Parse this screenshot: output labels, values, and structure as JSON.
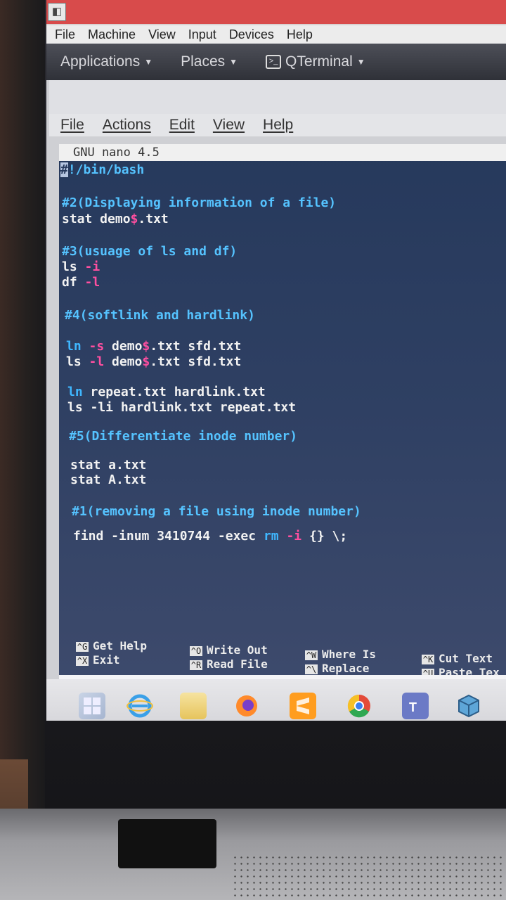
{
  "vbox": {
    "menu": [
      "File",
      "Machine",
      "View",
      "Input",
      "Devices",
      "Help"
    ]
  },
  "gnome_panel": {
    "applications": "Applications",
    "places": "Places",
    "terminal": "QTerminal"
  },
  "qterminal": {
    "menu": [
      "File",
      "Actions",
      "Edit",
      "View",
      "Help"
    ]
  },
  "nano": {
    "title": "GNU nano 4.5",
    "lines": {
      "shebang_hash": "#",
      "shebang_rest": "!/bin/bash",
      "c2": "#2(Displaying information of a file)",
      "stat_pre": "stat demo",
      "stat_dollar": "$",
      "stat_post": ".txt",
      "c3": "#3(usuage of ls and df)",
      "ls": "ls ",
      "ls_flag": "-i",
      "df": "df ",
      "df_flag": "-l",
      "c4": "#4(softlink and hardlink)",
      "ln1_cmd": "ln",
      "ln1_flag": "-s",
      "ln1_pre": " demo",
      "ln1_dollar": "$",
      "ln1_post": ".txt sfd.txt",
      "ls2": "ls ",
      "ls2_flag": "-l",
      "ls2_pre": " demo",
      "ls2_dollar": "$",
      "ls2_post": ".txt sfd.txt",
      "ln2_cmd": "ln",
      "ln2_rest": " repeat.txt hardlink.txt",
      "ls3": "ls -li hardlink.txt repeat.txt",
      "c5": "#5(Differentiate inode number)",
      "stat_a": "stat a.txt",
      "stat_A": "stat A.txt",
      "c1": "#1(removing a file using inode number)",
      "find_pre": "find -inum 3410744 -exec ",
      "find_rm": "rm",
      "find_flag": "-i",
      "find_post": " {} ",
      "find_end": "\\;"
    },
    "shortcuts": [
      {
        "key": "^G",
        "label": "Get Help"
      },
      {
        "key": "^X",
        "label": "Exit"
      },
      {
        "key": "^O",
        "label": "Write Out"
      },
      {
        "key": "^R",
        "label": "Read File"
      },
      {
        "key": "^W",
        "label": "Where Is"
      },
      {
        "key": "^\\",
        "label": "Replace"
      },
      {
        "key": "^K",
        "label": "Cut Text"
      },
      {
        "key": "^U",
        "label": "Paste Tex"
      }
    ]
  },
  "taskbar": {
    "icons": [
      "windows-start-icon",
      "internet-explorer-icon",
      "file-explorer-icon",
      "firefox-icon",
      "sublime-text-icon",
      "chrome-icon",
      "teams-icon",
      "virtualbox-icon"
    ]
  },
  "colors": {
    "comment": "#55c3ff",
    "flag": "#ff4fa0",
    "terminal_bg": "#2f4063"
  }
}
